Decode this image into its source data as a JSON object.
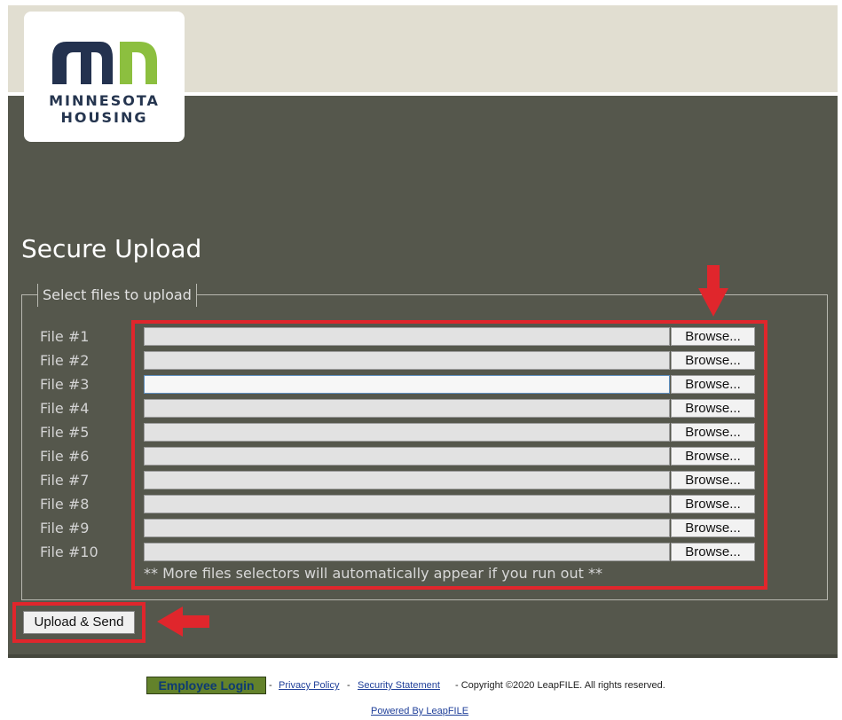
{
  "brand": {
    "logo_line1": "MINNESOTA",
    "logo_line2": "HOUSING",
    "logo_navy": "#24324f",
    "logo_green": "#8cbf3f"
  },
  "colors": {
    "panel_bg": "#55574c",
    "header_bg": "#e1ded1",
    "annotation_red": "#e0262c"
  },
  "upload": {
    "title": "Secure Upload",
    "legend": "Select files to upload",
    "browse_label": "Browse...",
    "files": [
      {
        "label": "File #1",
        "value": ""
      },
      {
        "label": "File #2",
        "value": ""
      },
      {
        "label": "File #3",
        "value": ""
      },
      {
        "label": "File #4",
        "value": ""
      },
      {
        "label": "File #5",
        "value": ""
      },
      {
        "label": "File #6",
        "value": ""
      },
      {
        "label": "File #7",
        "value": ""
      },
      {
        "label": "File #8",
        "value": ""
      },
      {
        "label": "File #9",
        "value": ""
      },
      {
        "label": "File #10",
        "value": ""
      }
    ],
    "focused_index": 2,
    "hint": "** More files selectors will automatically appear if you run out **",
    "submit_label": "Upload & Send"
  },
  "footer": {
    "employee_login": "Employee Login",
    "sep1": " - ",
    "privacy": "Privacy Policy",
    "sep2": " - ",
    "security": "Security Statement",
    "copyright": " - Copyright ©2020 LeapFILE. All rights reserved.",
    "powered": "Powered By LeapFILE"
  }
}
